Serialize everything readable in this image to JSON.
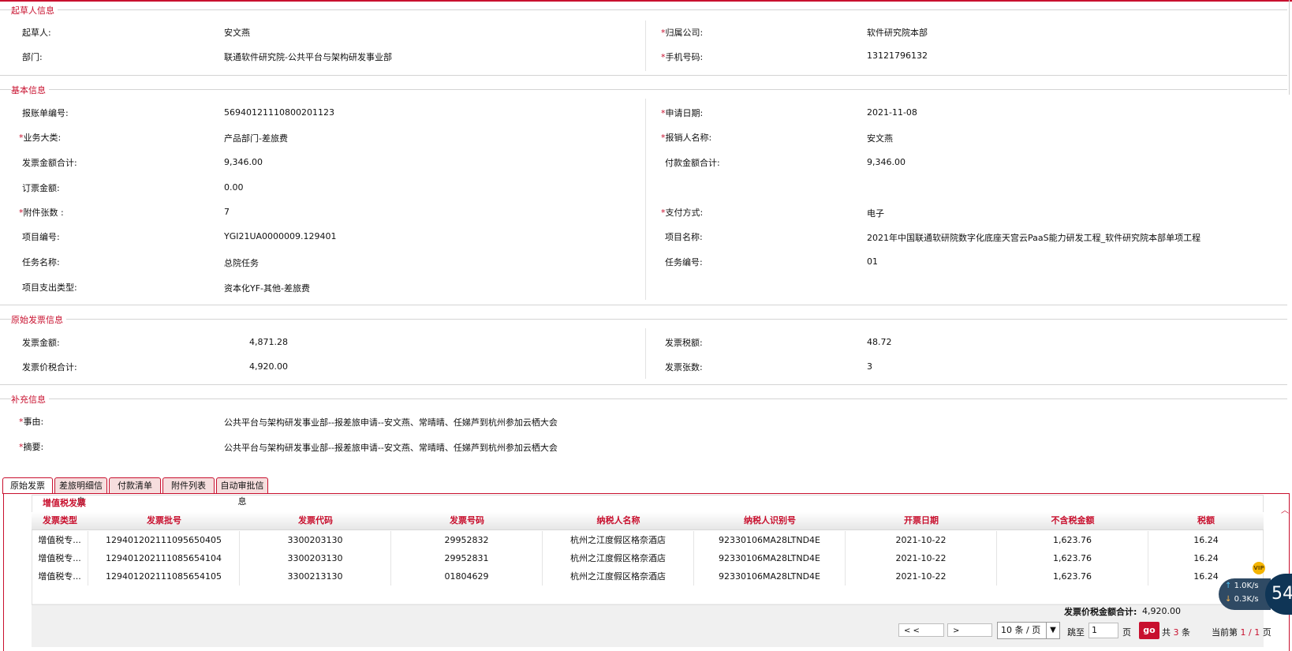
{
  "sections": {
    "drafter": {
      "title": "起草人信息",
      "fields": [
        {
          "label": "起草人:",
          "value": "安文燕",
          "required": false
        },
        {
          "label": "归属公司:",
          "value": "软件研究院本部",
          "required": true
        },
        {
          "label": "部门:",
          "value": "联通软件研究院-公共平台与架构研发事业部",
          "required": false
        },
        {
          "label": "手机号码:",
          "value": "13121796132",
          "required": true
        }
      ]
    },
    "basic": {
      "title": "基本信息",
      "fields": [
        {
          "label": "报账单编号:",
          "value": "56940121110800201123",
          "required": false
        },
        {
          "label": "申请日期:",
          "value": "2021-11-08",
          "required": true
        },
        {
          "label": "业务大类:",
          "value": "产品部门-差旅费",
          "required": true
        },
        {
          "label": "报销人名称:",
          "value": "安文燕",
          "required": true
        },
        {
          "label": "发票金额合计:",
          "value": "9,346.00",
          "required": false
        },
        {
          "label": "付款金额合计:",
          "value": "9,346.00",
          "required": false
        },
        {
          "label": "订票金额:",
          "value": "0.00",
          "required": false
        },
        {
          "label": "附件张数 :",
          "value": "7",
          "required": true
        },
        {
          "label": "支付方式:",
          "value": "电子",
          "required": true
        },
        {
          "label": "项目编号:",
          "value": "YGI21UA0000009.129401",
          "required": false
        },
        {
          "label": "项目名称:",
          "value": "2021年中国联通软研院数字化底座天宫云PaaS能力研发工程_软件研究院本部单项工程",
          "required": false
        },
        {
          "label": "任务名称:",
          "value": "总院任务",
          "required": false
        },
        {
          "label": "任务编号:",
          "value": "01",
          "required": false
        },
        {
          "label": "项目支出类型:",
          "value": "资本化YF-其他-差旅费",
          "required": false
        }
      ]
    },
    "invoice": {
      "title": "原始发票信息",
      "fields": [
        {
          "label": "发票金额:",
          "value": "4,871.28"
        },
        {
          "label": "发票税额:",
          "value": "48.72"
        },
        {
          "label": "发票价税合计:",
          "value": "4,920.00"
        },
        {
          "label": "发票张数:",
          "value": "3"
        }
      ]
    },
    "supplement": {
      "title": "补充信息",
      "fields": [
        {
          "label": "事由:",
          "value": "公共平台与架构研发事业部--报差旅申请--安文燕、常晴晴、任娣芦到杭州参加云栖大会",
          "required": true
        },
        {
          "label": "摘要:",
          "value": "公共平台与架构研发事业部--报差旅申请--安文燕、常晴晴、任娣芦到杭州参加云栖大会",
          "required": true
        }
      ]
    }
  },
  "tabs": [
    "原始发票",
    "差旅明细信息",
    "付款清单",
    "附件列表",
    "自动审批信息"
  ],
  "active_tab": "原始发票",
  "vat_table": {
    "title": "增值税发票",
    "columns": [
      "发票类型",
      "发票批号",
      "发票代码",
      "发票号码",
      "纳税人名称",
      "纳税人识别号",
      "开票日期",
      "不含税金额",
      "税额"
    ],
    "rows": [
      [
        "增值税专...",
        "129401202111095650405",
        "3300203130",
        "29952832",
        "杭州之江度假区格奈酒店",
        "92330106MA28LTND4E",
        "2021-10-22",
        "1,623.76",
        "16.24"
      ],
      [
        "增值税专...",
        "129401202111085654104",
        "3300203130",
        "29952831",
        "杭州之江度假区格奈酒店",
        "92330106MA28LTND4E",
        "2021-10-22",
        "1,623.76",
        "16.24"
      ],
      [
        "增值税专...",
        "129401202111085654105",
        "3300213130",
        "01804629",
        "杭州之江度假区格奈酒店",
        "92330106MA28LTND4E",
        "2021-10-22",
        "1,623.76",
        "16.24"
      ]
    ],
    "total_label": "发票价税金额合计:",
    "total_value": "4,920.00"
  },
  "pagination": {
    "prev": "< <",
    "next": ">",
    "page_size": "10 条 / 页",
    "jump_label": "跳至",
    "jump_value": "1",
    "page_unit": "页",
    "go": "go",
    "total_prefix": "共",
    "total_count": "3",
    "total_suffix": "条",
    "current_prefix": "当前第",
    "current": "1 / 1",
    "current_suffix": "页"
  },
  "widget": {
    "up": "1.0K/s",
    "down": "0.3K/s",
    "value": "54",
    "vip": "VIP"
  }
}
